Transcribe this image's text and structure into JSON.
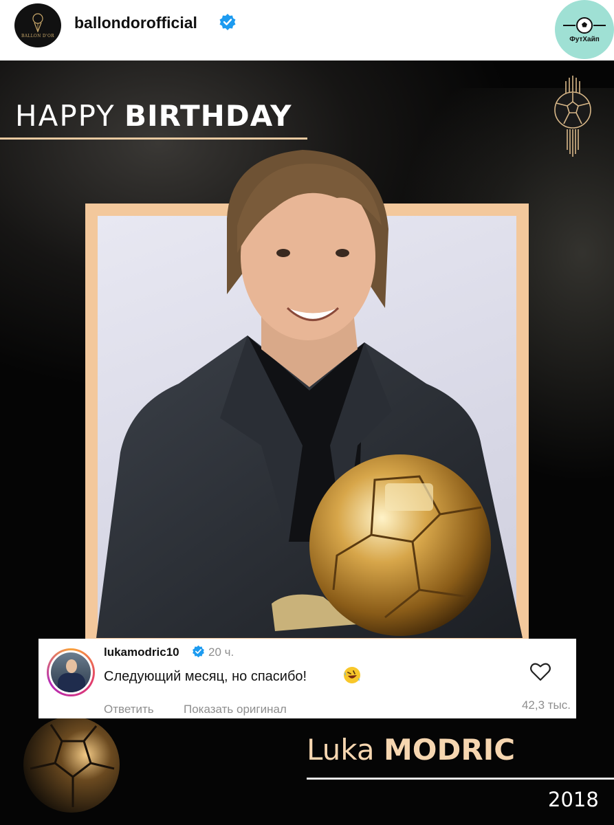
{
  "header": {
    "avatar_text": "BALLON D'OR",
    "username": "ballondorofficial",
    "verified_icon": "verified-badge-icon",
    "watermark_label": "ФутХайп"
  },
  "poster": {
    "title_light": "HAPPY",
    "title_bold": "BIRTHDAY",
    "player_first": "Luka",
    "player_last": "MODRIC",
    "year": "2018",
    "colors": {
      "frame": "#f3c89c",
      "gold_text": "#f6d6b0",
      "background": "#0a0a0a"
    }
  },
  "comment": {
    "username": "lukamodric10",
    "time": "20 ч.",
    "text": "Следующий месяц, но спасибо!",
    "emoji": "rolling-on-floor-laughing-emoji",
    "reply_label": "Ответить",
    "show_original_label": "Показать оригинал",
    "likes": "42,3 тыс.",
    "like_icon": "heart-icon"
  }
}
